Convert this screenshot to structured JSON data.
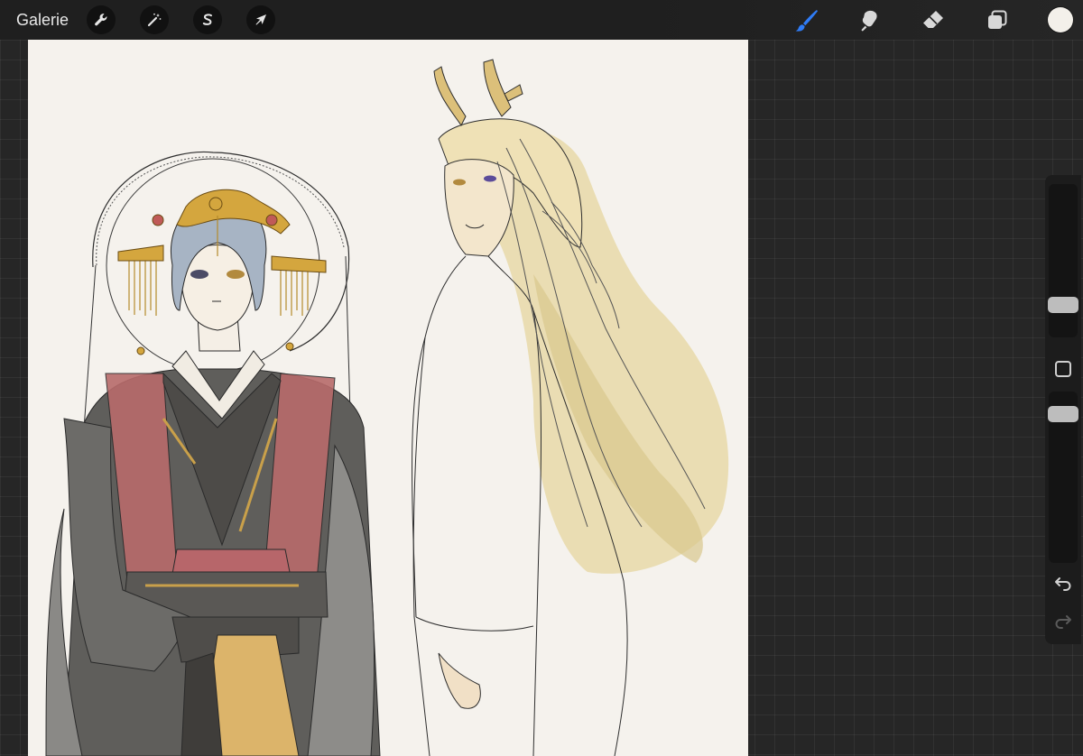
{
  "topbar": {
    "gallery_label": "Galerie",
    "left_tools": [
      {
        "name": "actions",
        "icon": "wrench-icon"
      },
      {
        "name": "adjustments",
        "icon": "magic-wand-icon"
      },
      {
        "name": "selection",
        "icon": "selection-s-icon"
      },
      {
        "name": "transform",
        "icon": "arrow-cursor-icon"
      }
    ],
    "right_tools": [
      {
        "name": "brush",
        "icon": "brush-icon",
        "active": true
      },
      {
        "name": "smudge",
        "icon": "smudge-icon",
        "active": false
      },
      {
        "name": "eraser",
        "icon": "eraser-icon",
        "active": false
      },
      {
        "name": "layers",
        "icon": "layers-icon",
        "active": false
      }
    ],
    "current_color": "#f3f0ea"
  },
  "sidebar": {
    "brush_size_icon": "brush-size-slider",
    "opacity_icon": "opacity-slider",
    "modify_icon": "square-modify-icon",
    "undo_icon": "undo-arrow-icon",
    "redo_icon": "redo-arrow-icon",
    "redo_enabled": false
  },
  "canvas": {
    "background_color": "#f5f2ed",
    "accent_active": "#2f7cf6"
  }
}
